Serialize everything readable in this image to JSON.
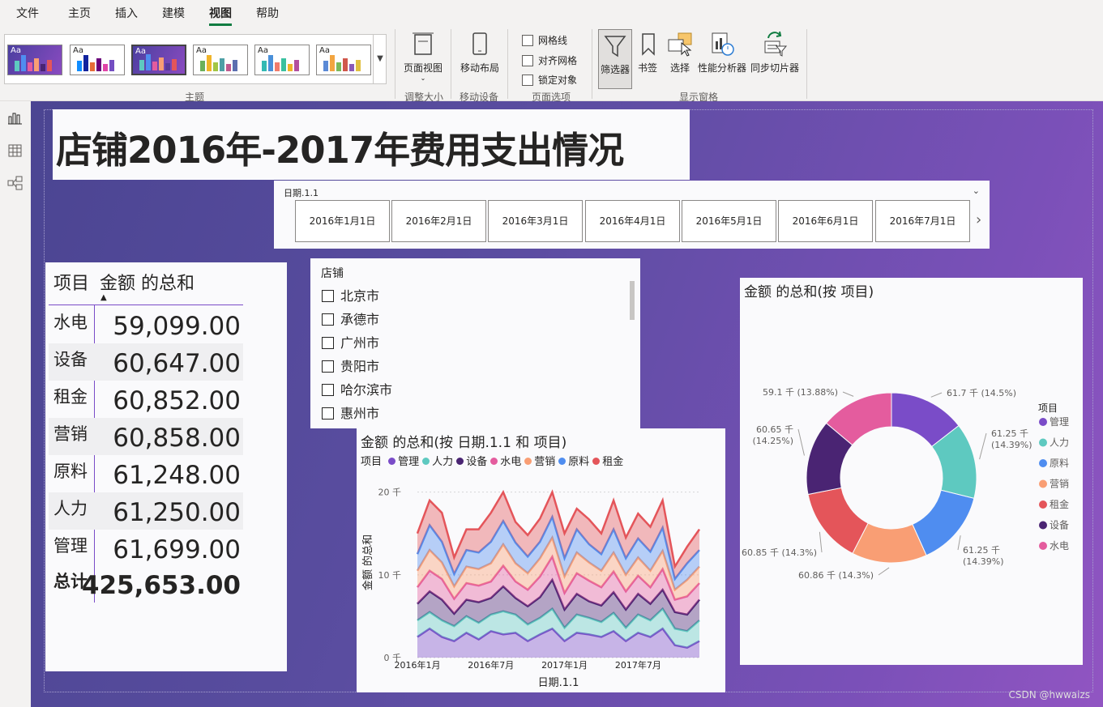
{
  "menu": {
    "items": [
      "文件",
      "主页",
      "插入",
      "建模",
      "视图",
      "帮助"
    ],
    "active": "视图"
  },
  "ribbon": {
    "groups": {
      "themes": "主题",
      "resize": "调整大小",
      "mobile": "移动设备",
      "page_options": "页面选项",
      "show_panes": "显示窗格"
    },
    "buttons": {
      "page_view": "页面视图",
      "mobile_layout": "移动布局",
      "filters": "筛选器",
      "bookmarks": "书签",
      "selection": "选择",
      "performance": "性能分析器",
      "sync_slicers": "同步切片器"
    },
    "checkboxes": [
      "网格线",
      "对齐网格",
      "锁定对象"
    ],
    "theme_aa": "Aa"
  },
  "report": {
    "title": "店铺2016年-2017年费用支出情况"
  },
  "date_slicer": {
    "label": "日期.1.1",
    "dates": [
      "2016年1月1日",
      "2016年2月1日",
      "2016年3月1日",
      "2016年4月1日",
      "2016年5月1日",
      "2016年6月1日",
      "2016年7月1日"
    ]
  },
  "table": {
    "headers": [
      "项目",
      "金额 的总和"
    ],
    "rows": [
      {
        "item": "水电",
        "value": "59,099.00"
      },
      {
        "item": "设备",
        "value": "60,647.00"
      },
      {
        "item": "租金",
        "value": "60,852.00"
      },
      {
        "item": "营销",
        "value": "60,858.00"
      },
      {
        "item": "原料",
        "value": "61,248.00"
      },
      {
        "item": "人力",
        "value": "61,250.00"
      },
      {
        "item": "管理",
        "value": "61,699.00"
      }
    ],
    "total_label": "总计",
    "total_value": "425,653.00"
  },
  "store_slicer": {
    "label": "店铺",
    "items": [
      "北京市",
      "承德市",
      "广州市",
      "贵阳市",
      "哈尔滨市",
      "惠州市"
    ]
  },
  "colors": {
    "管理": "#7a4cc8",
    "人力": "#5ec9c0",
    "设备": "#4a2473",
    "水电": "#e45c9e",
    "营销": "#f99e74",
    "原料": "#4f8df0",
    "租金": "#e4555a"
  },
  "chart_data": [
    {
      "type": "area",
      "title": "金额 的总和(按 日期.1.1 和 项目)",
      "legend_title": "项目",
      "xlabel": "日期.1.1",
      "ylabel": "金额 的总和",
      "x_ticks": [
        "2016年1月",
        "2016年7月",
        "2017年1月",
        "2017年7月"
      ],
      "y_ticks": [
        "0 千",
        "10 千",
        "20 千"
      ],
      "ylim": [
        0,
        23
      ],
      "stacked": true,
      "x": [
        "2016-01",
        "2016-02",
        "2016-03",
        "2016-04",
        "2016-05",
        "2016-06",
        "2016-07",
        "2016-08",
        "2016-09",
        "2016-10",
        "2016-11",
        "2016-12",
        "2017-01",
        "2017-02",
        "2017-03",
        "2017-04",
        "2017-05",
        "2017-06",
        "2017-07",
        "2017-08",
        "2017-09",
        "2017-10",
        "2017-11",
        "2017-12"
      ],
      "series": [
        {
          "name": "管理",
          "values": [
            2.5,
            3.5,
            2.5,
            2.0,
            3.0,
            2.2,
            3.2,
            2.8,
            3.0,
            2.0,
            2.8,
            3.5,
            2.0,
            3.0,
            2.8,
            2.5,
            3.2,
            2.0,
            3.0,
            2.5,
            3.5,
            1.5,
            1.2,
            2.0
          ]
        },
        {
          "name": "人力",
          "values": [
            2.0,
            2.0,
            2.0,
            1.8,
            2.0,
            2.0,
            2.0,
            2.8,
            2.2,
            2.0,
            2.0,
            2.4,
            1.6,
            2.2,
            2.0,
            1.8,
            2.2,
            1.6,
            2.2,
            2.0,
            2.4,
            2.0,
            2.0,
            2.5
          ]
        },
        {
          "name": "设备",
          "values": [
            2.0,
            2.5,
            2.5,
            1.5,
            2.0,
            2.5,
            2.0,
            3.0,
            2.0,
            2.2,
            2.5,
            3.5,
            2.2,
            2.5,
            2.0,
            2.0,
            2.5,
            2.2,
            2.5,
            2.0,
            2.3,
            2.0,
            2.0,
            2.5
          ]
        },
        {
          "name": "水电",
          "values": [
            2.0,
            2.5,
            2.5,
            1.8,
            2.0,
            2.0,
            2.0,
            2.5,
            2.0,
            2.0,
            2.5,
            2.8,
            2.0,
            2.5,
            2.5,
            2.2,
            2.5,
            2.2,
            2.2,
            2.0,
            2.5,
            1.5,
            2.2,
            2.0
          ]
        },
        {
          "name": "营销",
          "values": [
            2.0,
            2.5,
            2.0,
            1.5,
            2.0,
            2.0,
            2.2,
            2.6,
            2.2,
            2.0,
            2.2,
            2.3,
            2.0,
            2.5,
            2.2,
            2.0,
            2.3,
            2.0,
            2.2,
            2.0,
            2.2,
            1.2,
            2.0,
            2.0
          ]
        },
        {
          "name": "原料",
          "values": [
            2.0,
            3.0,
            2.5,
            1.5,
            2.0,
            2.0,
            2.6,
            2.8,
            2.5,
            2.0,
            2.0,
            2.5,
            2.2,
            2.8,
            2.2,
            2.0,
            2.8,
            2.0,
            2.3,
            2.3,
            2.8,
            1.3,
            2.0,
            2.0
          ]
        },
        {
          "name": "租金",
          "values": [
            2.5,
            3.0,
            3.5,
            2.0,
            2.5,
            2.8,
            3.5,
            3.5,
            2.5,
            2.6,
            2.8,
            3.0,
            3.0,
            2.5,
            3.0,
            2.5,
            3.5,
            2.5,
            3.0,
            3.0,
            3.3,
            1.5,
            2.0,
            2.5
          ]
        }
      ]
    },
    {
      "type": "pie",
      "title": "金额 的总和(按 项目)",
      "legend_title": "项目",
      "categories": [
        "管理",
        "人力",
        "原料",
        "营销",
        "租金",
        "设备",
        "水电"
      ],
      "values": [
        61.7,
        61.25,
        61.25,
        60.86,
        60.85,
        60.65,
        59.1
      ],
      "labels": [
        [
          "61.7 千 (14.5%)"
        ],
        [
          "61.25 千",
          "(14.39%)"
        ],
        [
          "61.25 千",
          "(14.39%)"
        ],
        [
          "60.86 千 (14.3%)"
        ],
        [
          "60.85 千 (14.3%)"
        ],
        [
          "60.65 千",
          "(14.25%)"
        ],
        [
          "59.1 千 (13.88%)"
        ]
      ]
    }
  ],
  "watermark": "CSDN @hwwaizs"
}
